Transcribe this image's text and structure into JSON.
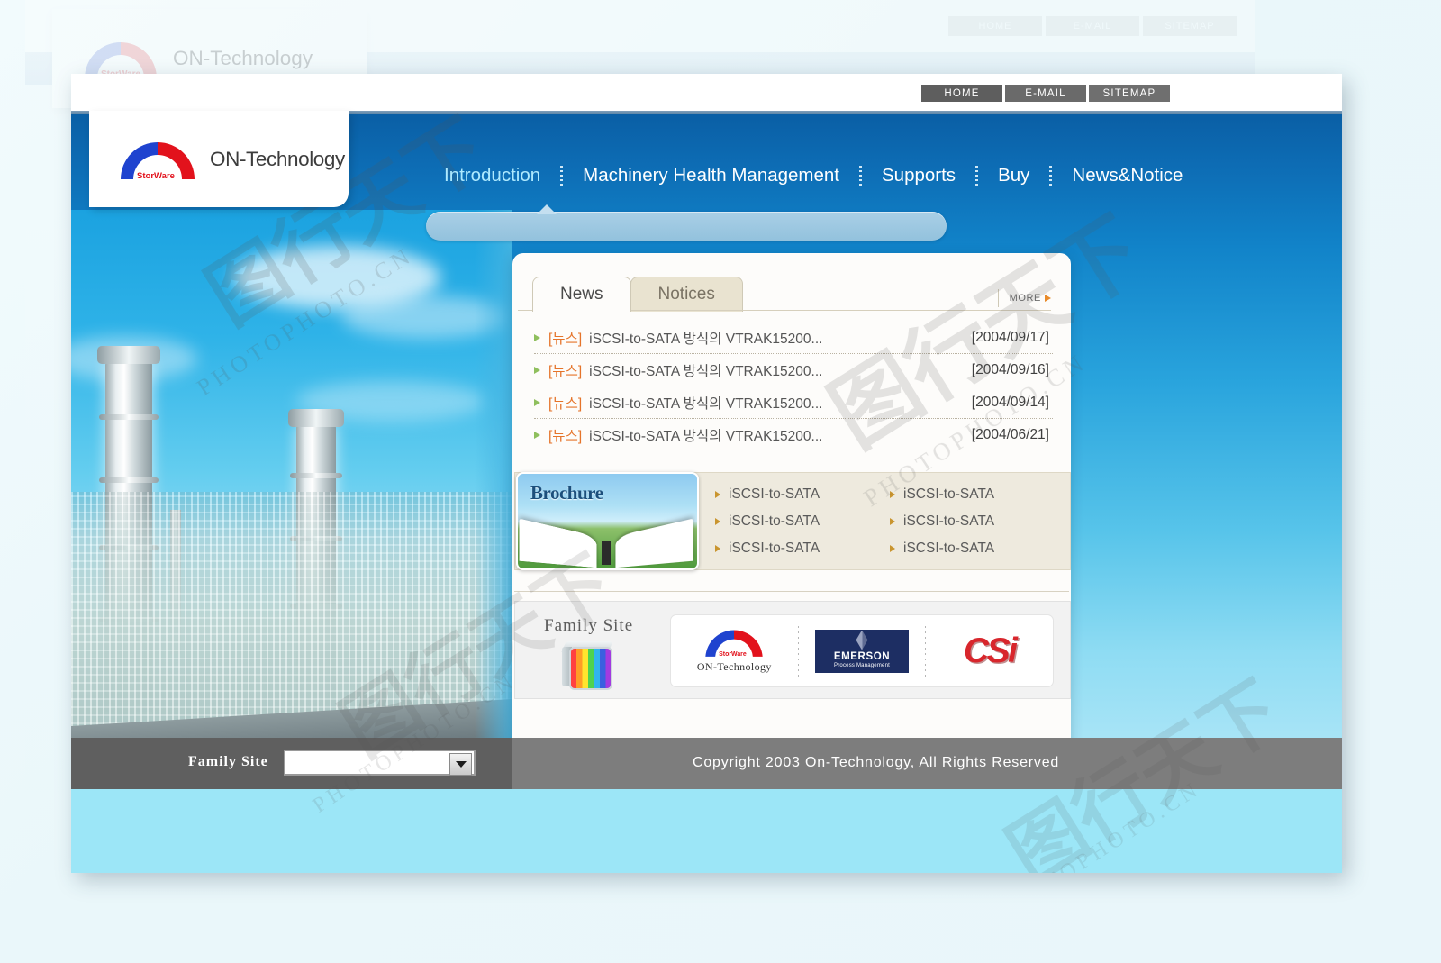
{
  "site": {
    "brand_name": "ON-Technology",
    "brand_sub": "StorWare",
    "logo_icon": "arch-logo-icon"
  },
  "utility_bar": {
    "buttons": [
      {
        "label": "HOME",
        "name": "home-button"
      },
      {
        "label": "E-MAIL",
        "name": "email-button"
      },
      {
        "label": "SITEMAP",
        "name": "sitemap-button"
      }
    ]
  },
  "main_nav": {
    "items": [
      {
        "label": "Introduction",
        "active": true
      },
      {
        "label": "Machinery Health Management",
        "active": false
      },
      {
        "label": "Supports",
        "active": false
      },
      {
        "label": "Buy",
        "active": false
      },
      {
        "label": "News&Notice",
        "active": false
      }
    ]
  },
  "board": {
    "tabs": [
      {
        "label": "News",
        "active": true
      },
      {
        "label": "Notices",
        "active": false
      }
    ],
    "more_label": "MORE",
    "items": [
      {
        "tag": "[뉴스]",
        "title": "iSCSI-to-SATA 방식의 VTRAK15200...",
        "date": "[2004/09/17]"
      },
      {
        "tag": "[뉴스]",
        "title": "iSCSI-to-SATA 방식의 VTRAK15200...",
        "date": "[2004/09/16]"
      },
      {
        "tag": "[뉴스]",
        "title": "iSCSI-to-SATA 방식의 VTRAK15200...",
        "date": "[2004/09/14]"
      },
      {
        "tag": "[뉴스]",
        "title": "iSCSI-to-SATA 방식의 VTRAK15200...",
        "date": "[2004/06/21]"
      }
    ]
  },
  "brochure": {
    "image_label": "Brochure",
    "links": [
      "iSCSI-to-SATA",
      "iSCSI-to-SATA",
      "iSCSI-to-SATA",
      "iSCSI-to-SATA",
      "iSCSI-to-SATA",
      "iSCSI-to-SATA"
    ]
  },
  "family_site": {
    "title": "Family Site",
    "cube_icon": "rainbow-cube-icon",
    "logos": [
      {
        "name": "on-technology-logo",
        "text": "ON-Technology",
        "sub": "StorWare"
      },
      {
        "name": "emerson-logo",
        "text": "EMERSON",
        "sub": "Process Management"
      },
      {
        "name": "csi-logo",
        "text": "CSi",
        "sub": ""
      }
    ]
  },
  "footer": {
    "family_site_label": "Family Site",
    "select_value": "",
    "select_placeholder": "",
    "dropdown_icon": "chevron-down-icon",
    "copyright": "Copyright   2003 On-Technology, All Rights Reserved"
  },
  "watermarks": {
    "cn": "图行天下",
    "en": "PHOTOPHOTO.CN"
  },
  "colors": {
    "nav_blue": "#0d6cb4",
    "accent_orange": "#e5742a",
    "bullet_green": "#8fbf5d",
    "card_bg": "#fdfcfa",
    "footer_gray": "#7d7d7d",
    "cyan": "#9ce6f7"
  }
}
